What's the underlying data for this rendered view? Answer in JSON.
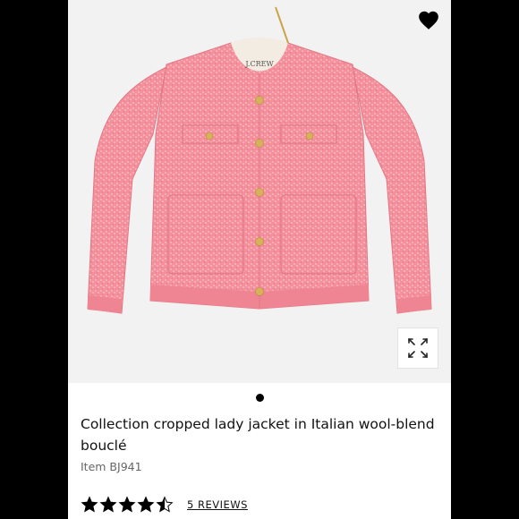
{
  "product": {
    "image_alt": "Pink bouclé cropped lady jacket",
    "brand_label": "J.CREW",
    "title": "Collection cropped lady jacket in Italian wool-blend bouclé",
    "item_number": "Item BJ941",
    "rating": 4.5,
    "rating_max": 5,
    "reviews_link": "5 REVIEWS"
  },
  "carousel": {
    "active_index": 0,
    "count": 1
  },
  "icons": {
    "favorite": "heart-icon",
    "expand": "expand-icon",
    "star": "star-icon"
  },
  "colors": {
    "jacket": "#f4909c",
    "jacket_light": "#f8b3bb",
    "jacket_dark": "#e27785",
    "buttons": "#d8b25a",
    "background": "#000000"
  }
}
